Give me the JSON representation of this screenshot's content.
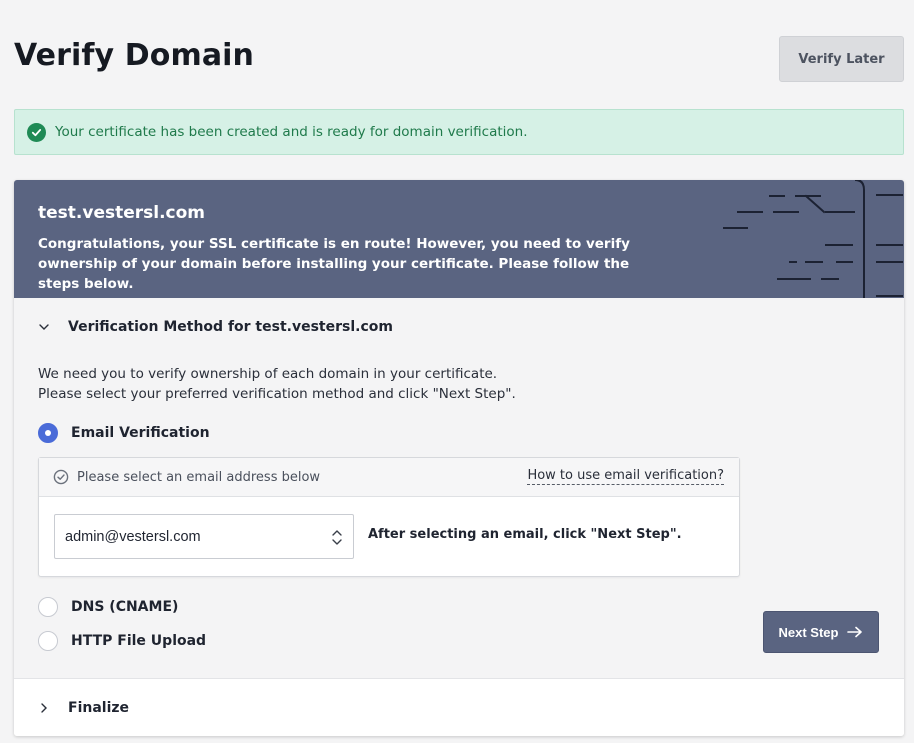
{
  "header": {
    "title": "Verify Domain",
    "verify_later_label": "Verify Later"
  },
  "alert": {
    "message": "Your certificate has been created and is ready for domain verification.",
    "icon": "check-circle-icon",
    "color": "#1f8a55"
  },
  "banner": {
    "domain": "test.vestersl.com",
    "message": "Congratulations, your SSL certificate is en route! However, you need to verify ownership of your domain before installing your certificate. Please follow the steps below.",
    "background": "#5a6481"
  },
  "verification": {
    "section_title": "Verification Method for test.vestersl.com",
    "intro_line1": "We need you to verify ownership of each domain in your certificate.",
    "intro_line2": "Please select your preferred verification method and click \"Next Step\".",
    "options": [
      {
        "label": "Email Verification",
        "selected": true
      },
      {
        "label": "DNS (CNAME)",
        "selected": false
      },
      {
        "label": "HTTP File Upload",
        "selected": false
      }
    ],
    "email_panel": {
      "header_text": "Please select an email address below",
      "help_link": "How to use email verification?",
      "selected_email": "admin@vestersl.com",
      "hint": "After selecting an email, click \"Next Step\"."
    },
    "next_button_label": "Next Step"
  },
  "finalize": {
    "title": "Finalize"
  },
  "colors": {
    "accent": "#4a6bd8",
    "primary": "#5a6481",
    "success_bg": "#d6f1e6"
  }
}
